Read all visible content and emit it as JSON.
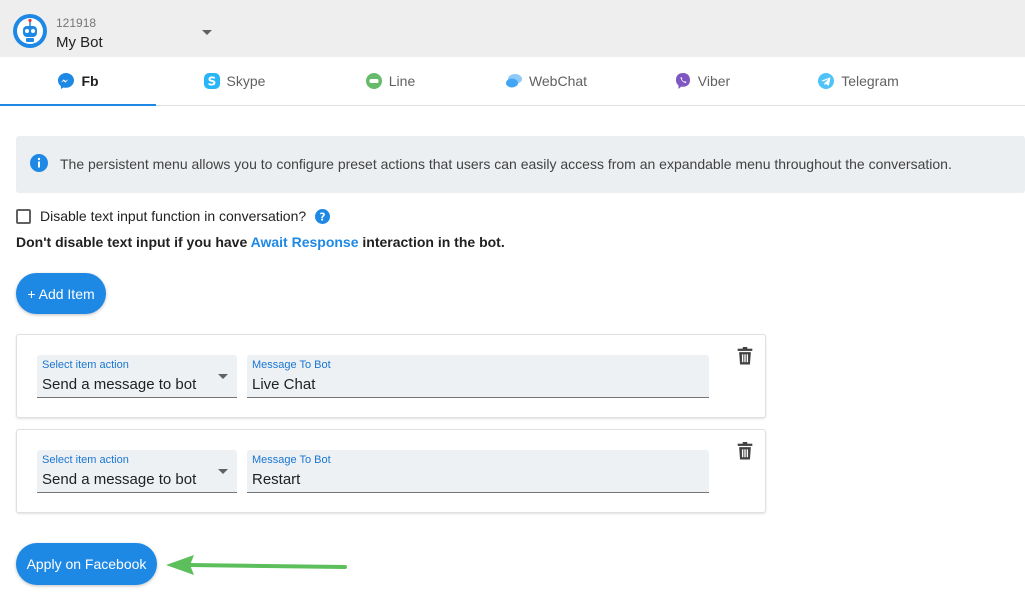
{
  "bot": {
    "id": "121918",
    "name": "My Bot"
  },
  "tabs": [
    {
      "label": "Fb",
      "icon": "messenger-icon",
      "active": true
    },
    {
      "label": "Skype",
      "icon": "skype-icon"
    },
    {
      "label": "Line",
      "icon": "line-icon"
    },
    {
      "label": "WebChat",
      "icon": "webchat-icon"
    },
    {
      "label": "Viber",
      "icon": "viber-icon"
    },
    {
      "label": "Telegram",
      "icon": "telegram-icon"
    }
  ],
  "info": {
    "text": "The persistent menu allows you to configure preset actions that users can easily access from an expandable menu throughout the conversation."
  },
  "disable_input": {
    "label": "Disable text input function in conversation?",
    "checked": false
  },
  "warning": {
    "prefix": "Don't disable text input if you have ",
    "link": "Await Response",
    "suffix": " interaction in the bot."
  },
  "add_item_label": "+ Add Item",
  "items": [
    {
      "action_label": "Select item action",
      "action_value": "Send a message to bot",
      "message_label": "Message To Bot",
      "message_value": "Live Chat"
    },
    {
      "action_label": "Select item action",
      "action_value": "Send a message to bot",
      "message_label": "Message To Bot",
      "message_value": "Restart"
    }
  ],
  "apply_label": "Apply on Facebook",
  "colors": {
    "primary": "#1e88e5",
    "annotation_arrow": "#5cbf5c"
  }
}
